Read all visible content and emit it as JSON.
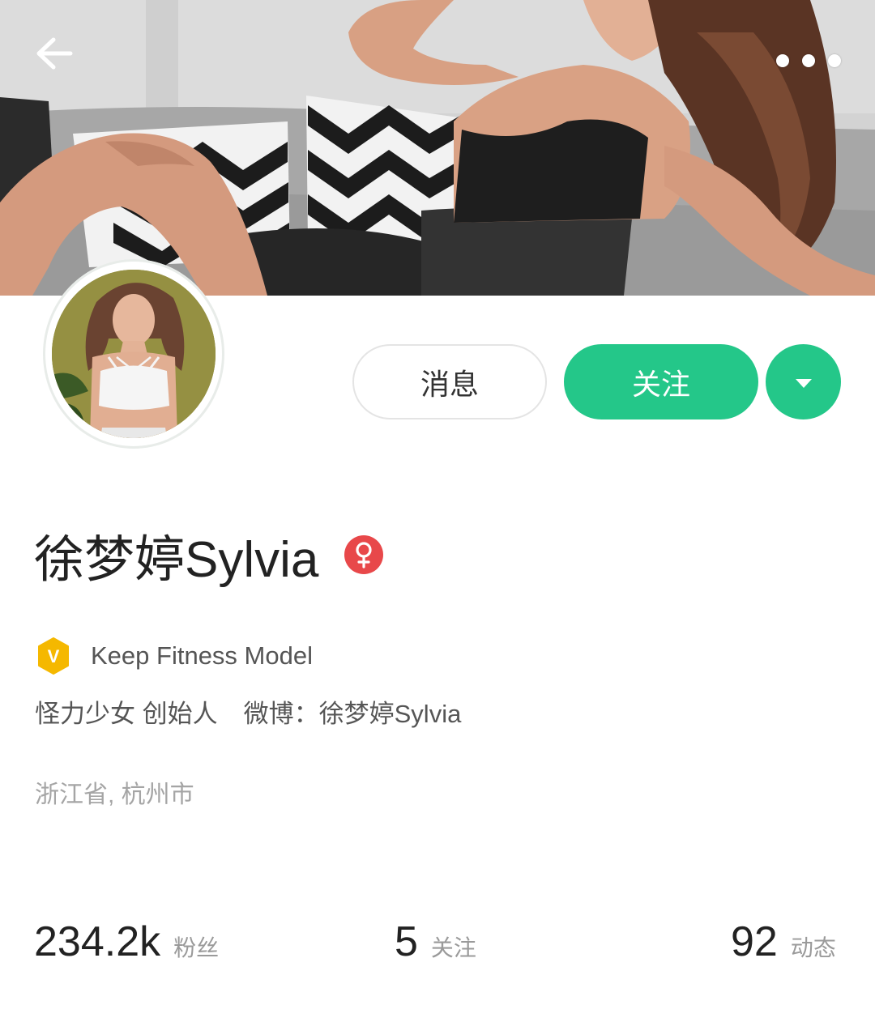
{
  "colors": {
    "accent_green": "#24c789",
    "gender_female_red": "#e8484a",
    "verify_gold": "#f5b800",
    "text_primary": "#222222",
    "text_secondary": "#555555",
    "text_muted": "#a5a5a5"
  },
  "header": {
    "back_icon": "arrow-left-icon",
    "more_icon": "more-dots-icon"
  },
  "actions": {
    "message_label": "消息",
    "follow_label": "关注",
    "dropdown_icon": "caret-down-icon"
  },
  "profile": {
    "name": "徐梦婷Sylvia",
    "gender_icon": "female-icon",
    "verify_badge_letter": "V",
    "verify_label": "Keep Fitness Model",
    "bio_part1": "怪力少女 创始人",
    "bio_part2": "微博：徐梦婷Sylvia",
    "location": "浙江省, 杭州市"
  },
  "stats": {
    "fans_count": "234.2k",
    "fans_label": "粉丝",
    "following_count": "5",
    "following_label": "关注",
    "posts_count": "92",
    "posts_label": "动态"
  }
}
